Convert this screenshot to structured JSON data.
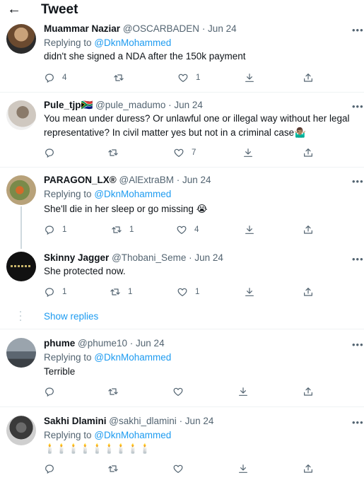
{
  "header": {
    "back_glyph": "←",
    "title": "Tweet"
  },
  "replying_prefix": "Replying to",
  "show_replies": "Show replies",
  "more_glyph": "•••",
  "tweets": [
    {
      "name": "Muammar Naziar",
      "handle": "@OSCARBADEN",
      "date": "· Jun 24",
      "replying_to": "@DknMohammed",
      "text": "didn't she signed a NDA after the 150k payment",
      "replies": "4",
      "retweets": "",
      "likes": "1"
    },
    {
      "name": "Pule_tjp🇿🇦",
      "handle": "@pule_madumo",
      "date": "· Jun 24",
      "text": "You mean under duress? Or unlawful one or illegal way without her legal representative? In civil matter yes but not in a criminal case🤷🏽‍♂️",
      "replies": "",
      "retweets": "",
      "likes": "7"
    },
    {
      "name": "PARAGON_LX®",
      "handle": "@AlExtraBM",
      "date": "· Jun 24",
      "replying_to": "@DknMohammed",
      "text": "She'll die in her sleep or go missing 😭",
      "replies": "1",
      "retweets": "1",
      "likes": "4"
    },
    {
      "name": "Skinny Jagger",
      "handle": "@Thobani_Seme",
      "date": "· Jun 24",
      "text": "She protected now.",
      "replies": "1",
      "retweets": "1",
      "likes": "1"
    },
    {
      "name": "phume",
      "handle": "@phume10",
      "date": "· Jun 24",
      "replying_to": "@DknMohammed",
      "text": "Terrible",
      "replies": "",
      "retweets": "",
      "likes": ""
    },
    {
      "name": "Sakhi Dlamini",
      "handle": "@sakhi_dlamini",
      "date": "· Jun 24",
      "replying_to": "@DknMohammed",
      "text": "🕯️🕯️🕯️🕯️🕯️🕯️🕯️🕯️🕯️",
      "replies": "",
      "retweets": "",
      "likes": ""
    }
  ],
  "colors": {
    "accent": "#1d9bf0",
    "muted": "#536471",
    "text": "#0f1419",
    "divider": "#eff3f4"
  },
  "icons": [
    "back-arrow-icon",
    "reply-icon",
    "retweet-icon",
    "like-icon",
    "download-icon",
    "share-icon",
    "more-icon"
  ]
}
